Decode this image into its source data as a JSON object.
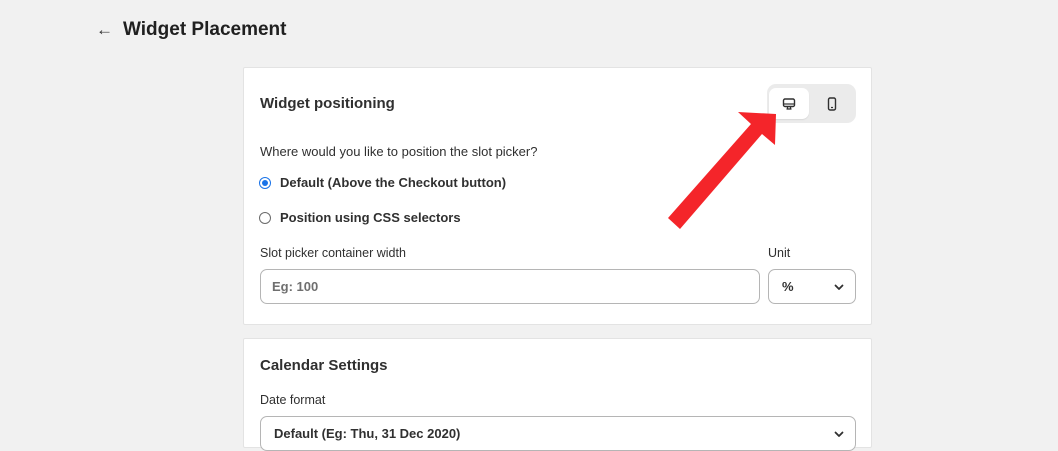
{
  "header": {
    "back_icon": "back-arrow-icon",
    "back_glyph": "←",
    "title": "Widget Placement"
  },
  "widget_positioning": {
    "title": "Widget positioning",
    "view_toggle": {
      "selected": "desktop",
      "options": [
        "desktop-icon",
        "mobile-icon"
      ]
    },
    "question": "Where would you like to position the slot picker?",
    "options": [
      {
        "label": "Default (Above the Checkout button)",
        "checked": true
      },
      {
        "label": "Position using CSS selectors",
        "checked": false
      }
    ],
    "width_field": {
      "label": "Slot picker container width",
      "placeholder": "Eg: 100",
      "value": ""
    },
    "unit_field": {
      "label": "Unit",
      "value": "%"
    }
  },
  "calendar_settings": {
    "title": "Calendar Settings",
    "date_format": {
      "label": "Date format",
      "value": "Default (Eg: Thu, 31 Dec 2020)"
    }
  },
  "annotation": {
    "type": "red-arrow",
    "color": "#f4252a"
  },
  "colors": {
    "accent": "#1a73e8",
    "background": "#f1f1f1",
    "card": "#ffffff"
  }
}
